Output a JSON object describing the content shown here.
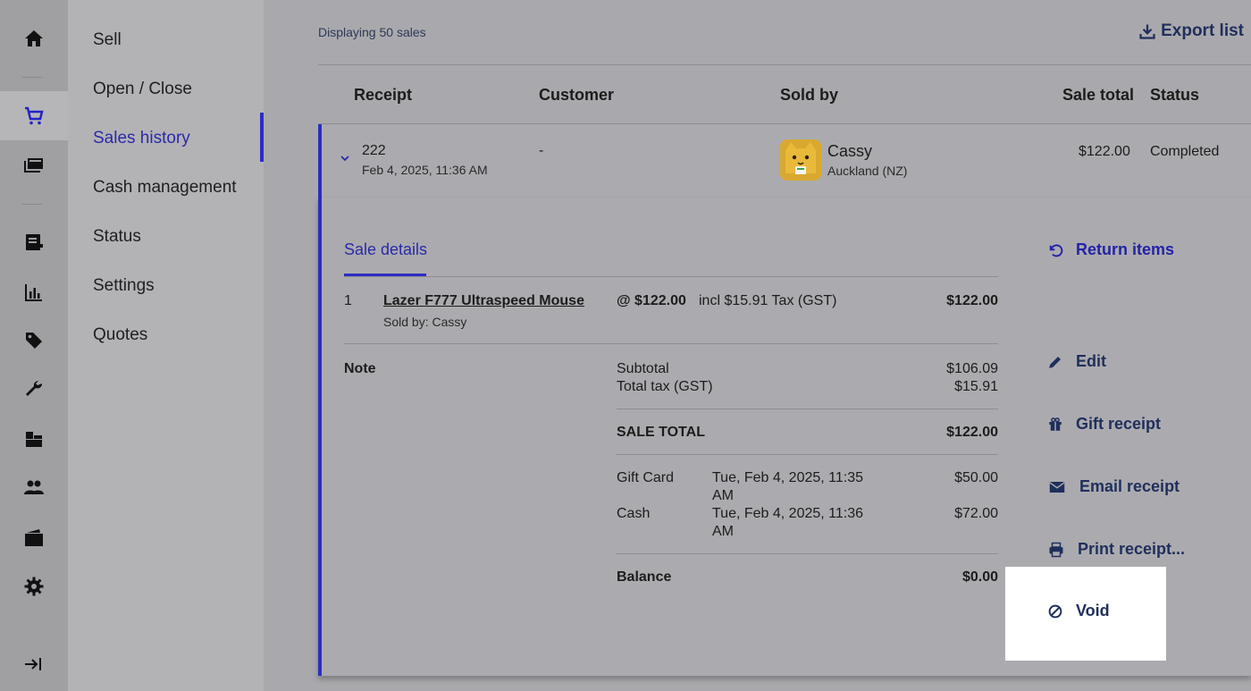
{
  "rail": {
    "items": [
      {
        "icon": "home-icon"
      },
      {
        "icon": "cart-icon",
        "active": true
      },
      {
        "icon": "register-icon"
      },
      {
        "icon": "receipt-icon"
      },
      {
        "icon": "reports-icon"
      },
      {
        "icon": "tag-icon"
      },
      {
        "icon": "wrench-icon"
      },
      {
        "icon": "inventory-icon"
      },
      {
        "icon": "customers-icon"
      },
      {
        "icon": "wallet-icon"
      },
      {
        "icon": "gear-icon"
      },
      {
        "icon": "expand-sidebar-icon"
      }
    ]
  },
  "subnav": {
    "items": [
      "Sell",
      "Open / Close",
      "Sales history",
      "Cash management",
      "Status",
      "Settings",
      "Quotes"
    ],
    "active": "Sales history"
  },
  "main": {
    "displaying": "Displaying 50 sales",
    "export_label": "Export list",
    "columns": {
      "receipt": "Receipt",
      "customer": "Customer",
      "sold_by": "Sold by",
      "sale_total": "Sale total",
      "status": "Status"
    },
    "row": {
      "receipt_no": "222",
      "date": "Feb 4, 2025, 11:36 AM",
      "customer": "-",
      "seller_name": "Cassy",
      "seller_location": "Auckland (NZ)",
      "total": "$122.00",
      "status": "Completed"
    }
  },
  "detail": {
    "tab": "Sale details",
    "line_item": {
      "qty": "1",
      "name": "Lazer F777 Ultraspeed Mouse",
      "sold_by": "Sold by: Cassy",
      "unit_price": "@ $122.00",
      "tax": "incl $15.91 Tax (GST)",
      "amount": "$122.00"
    },
    "note_label": "Note",
    "subtotal_label": "Subtotal",
    "subtotal": "$106.09",
    "tax_label": "Total tax (GST)",
    "tax": "$15.91",
    "sale_total_label": "SALE TOTAL",
    "sale_total": "$122.00",
    "payments": [
      {
        "method": "Gift Card",
        "date_line1": "Tue, Feb 4, 2025, 11:35",
        "date_line2": "AM",
        "amount": "$50.00"
      },
      {
        "method": "Cash",
        "date_line1": "Tue, Feb 4, 2025, 11:36",
        "date_line2": "AM",
        "amount": "$72.00"
      }
    ],
    "balance_label": "Balance",
    "balance": "$0.00",
    "actions": {
      "return": "Return items",
      "edit": "Edit",
      "gift": "Gift receipt",
      "email": "Email receipt",
      "print": "Print receipt...",
      "void": "Void"
    }
  },
  "colors": {
    "accent": "#2d2dc4",
    "link": "#1f2f5c"
  }
}
